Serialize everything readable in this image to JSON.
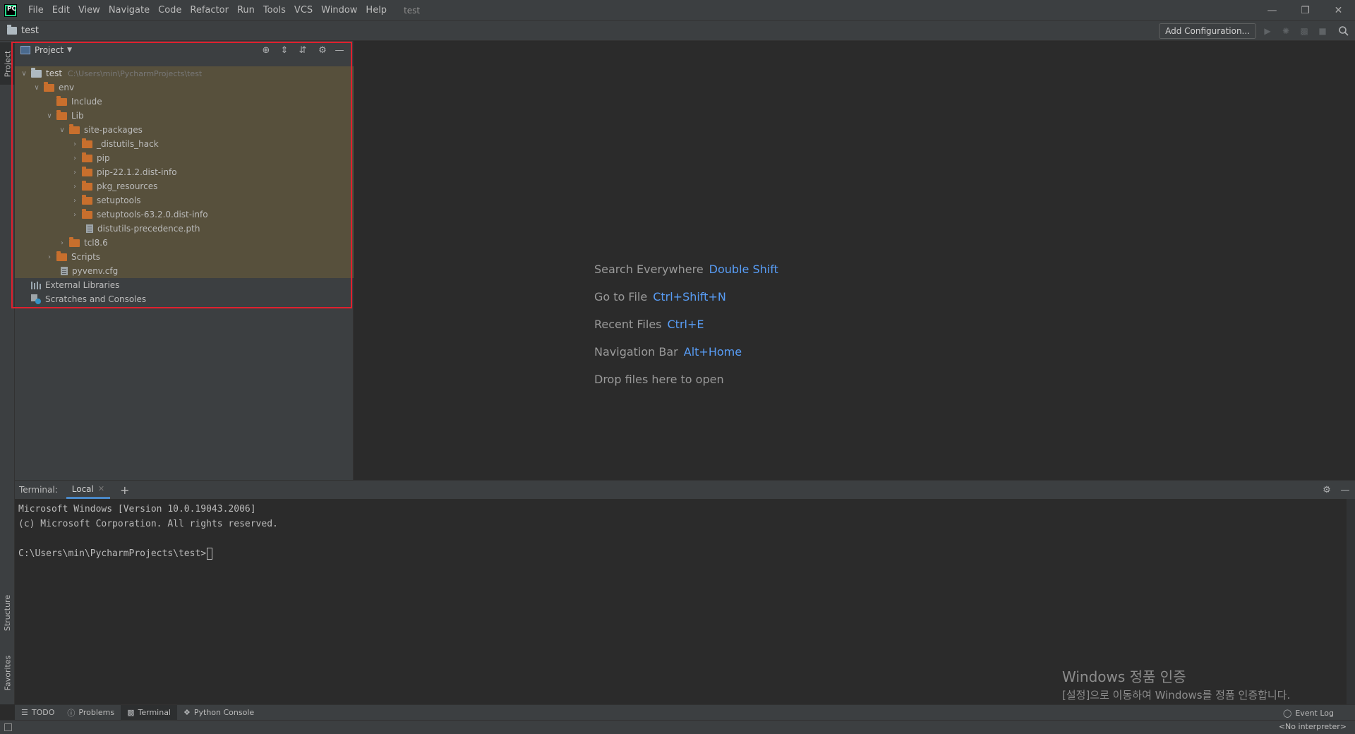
{
  "menu": {
    "items": [
      "File",
      "Edit",
      "View",
      "Navigate",
      "Code",
      "Refactor",
      "Run",
      "Tools",
      "VCS",
      "Window",
      "Help"
    ],
    "window_title": "test",
    "logo_text": "PC"
  },
  "navbar": {
    "project": "test",
    "add_configuration": "Add Configuration..."
  },
  "side_tabs": {
    "project": "Project",
    "structure": "Structure",
    "favorites": "Favorites"
  },
  "project_panel": {
    "title": "Project",
    "root": {
      "name": "test",
      "path": "C:\\Users\\min\\PycharmProjects\\test"
    },
    "tree": [
      {
        "label": "env"
      },
      {
        "label": "Include"
      },
      {
        "label": "Lib"
      },
      {
        "label": "site-packages"
      },
      {
        "label": "_distutils_hack"
      },
      {
        "label": "pip"
      },
      {
        "label": "pip-22.1.2.dist-info"
      },
      {
        "label": "pkg_resources"
      },
      {
        "label": "setuptools"
      },
      {
        "label": "setuptools-63.2.0.dist-info"
      },
      {
        "label": "distutils-precedence.pth"
      },
      {
        "label": "tcl8.6"
      },
      {
        "label": "Scripts"
      },
      {
        "label": "pyvenv.cfg"
      },
      {
        "label": "External Libraries"
      },
      {
        "label": "Scratches and Consoles"
      }
    ]
  },
  "editor": {
    "hints": [
      {
        "text": "Search Everywhere",
        "key": "Double Shift"
      },
      {
        "text": "Go to File",
        "key": "Ctrl+Shift+N"
      },
      {
        "text": "Recent Files",
        "key": "Ctrl+E"
      },
      {
        "text": "Navigation Bar",
        "key": "Alt+Home"
      },
      {
        "text": "Drop files here to open",
        "key": ""
      }
    ]
  },
  "terminal": {
    "title": "Terminal:",
    "tab": "Local",
    "lines": [
      "Microsoft Windows [Version 10.0.19043.2006]",
      "(c) Microsoft Corporation. All rights reserved.",
      "",
      "C:\\Users\\min\\PycharmProjects\\test>"
    ]
  },
  "bottom_tabs": {
    "todo": "TODO",
    "problems": "Problems",
    "terminal": "Terminal",
    "python_console": "Python Console",
    "event_log": "Event Log"
  },
  "status": {
    "interpreter": "<No interpreter>"
  },
  "watermark": {
    "title": "Windows 정품 인증",
    "subtitle": "[설정]으로 이동하여 Windows를 정품 인증합니다."
  },
  "colors": {
    "accent": "#589df6",
    "folder": "#c86f2d",
    "highlight": "#57503c",
    "annotation_box": "#e0202e"
  }
}
